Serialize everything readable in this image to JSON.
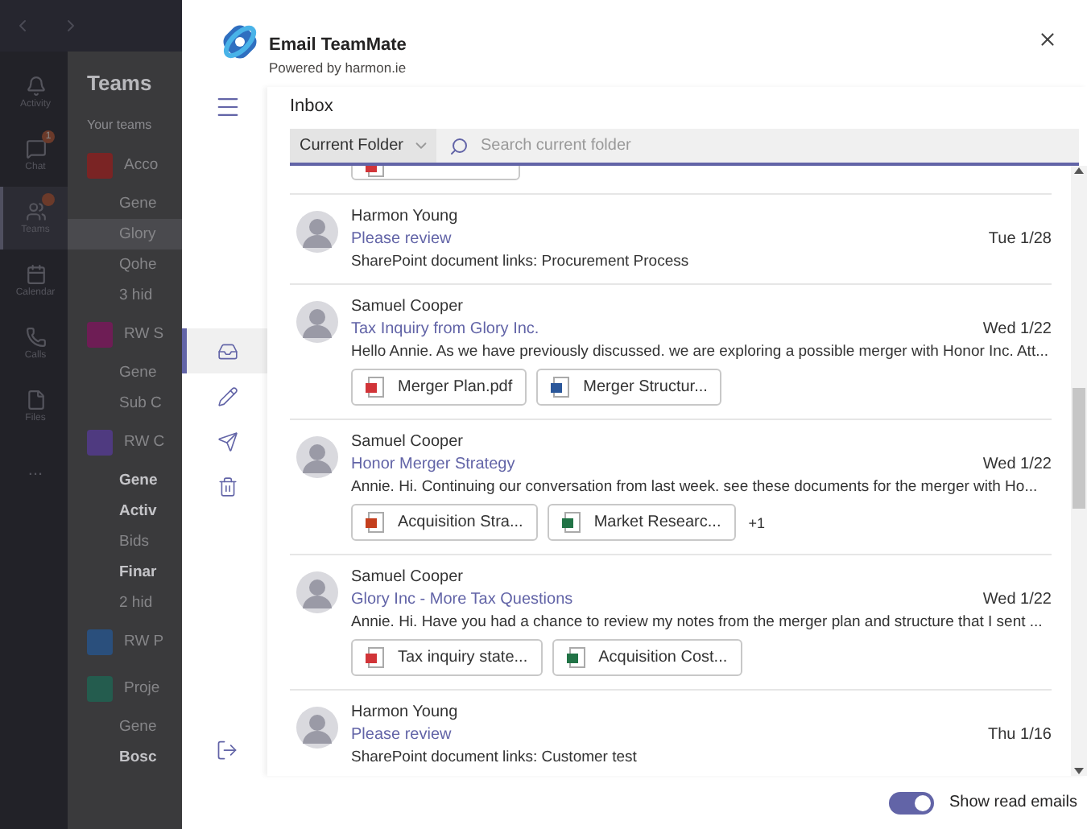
{
  "teams_app": {
    "nav": [
      {
        "kind": "activity",
        "label": "Activity",
        "notified": false
      },
      {
        "kind": "chat",
        "label": "Chat",
        "notified": true,
        "badge_count": "1"
      },
      {
        "kind": "teams",
        "label": "Teams",
        "notified": true,
        "selected": true
      },
      {
        "kind": "calendar",
        "label": "Calendar",
        "notified": false
      },
      {
        "kind": "calls",
        "label": "Calls",
        "notified": false
      },
      {
        "kind": "files",
        "label": "Files",
        "notified": false
      },
      {
        "kind": "more",
        "label": "...",
        "notified": false
      }
    ],
    "panel": {
      "title": "Teams",
      "section": "Your teams",
      "items": [
        {
          "kind": "team",
          "text": "Acco",
          "color": "#7a2424"
        },
        {
          "kind": "channel",
          "text": "Gene",
          "bold": false,
          "selected": false
        },
        {
          "kind": "channel",
          "text": "Glory",
          "bold": false,
          "selected": true
        },
        {
          "kind": "channel",
          "text": "Qohe",
          "bold": false,
          "selected": false
        },
        {
          "kind": "hidden",
          "text": "3 hid"
        },
        {
          "kind": "team",
          "text": "RW S",
          "color": "#6e1d55"
        },
        {
          "kind": "channel",
          "text": "Gene",
          "bold": false,
          "selected": false
        },
        {
          "kind": "channel",
          "text": "Sub C",
          "bold": false,
          "selected": false
        },
        {
          "kind": "team",
          "text": "RW C",
          "color": "#4f3a80"
        },
        {
          "kind": "channel",
          "text": "Gene",
          "bold": true,
          "selected": false
        },
        {
          "kind": "channel",
          "text": "Activ",
          "bold": true,
          "selected": false
        },
        {
          "kind": "channel",
          "text": "Bids",
          "bold": false,
          "selected": false
        },
        {
          "kind": "channel",
          "text": "Finar",
          "bold": true,
          "selected": false
        },
        {
          "kind": "hidden",
          "text": "2 hid"
        },
        {
          "kind": "team",
          "text": "RW P",
          "color": "#2a4f7c"
        },
        {
          "kind": "team",
          "text": "Proje",
          "color": "#245c4e"
        },
        {
          "kind": "channel",
          "text": "Gene",
          "bold": false,
          "selected": false
        },
        {
          "kind": "channel",
          "text": "Bosc",
          "bold": true,
          "selected": false
        }
      ]
    }
  },
  "dialog": {
    "app_name": "Email TeamMate",
    "tagline": "Powered by harmon.ie",
    "sidebar_actions": [
      {
        "kind": "inbox",
        "selected": true
      },
      {
        "kind": "compose",
        "selected": false
      },
      {
        "kind": "sent",
        "selected": false
      },
      {
        "kind": "trash",
        "selected": false
      }
    ],
    "folder": "Inbox",
    "scope": "Current Folder",
    "search": {
      "placeholder": "Search current folder"
    },
    "emails": [
      {
        "partial": true,
        "attachments": [
          {
            "kind": "pdf"
          }
        ]
      },
      {
        "sender": "Harmon Young",
        "subject": "Please review",
        "date": "Tue 1/28",
        "preview": "SharePoint document links: Procurement Process"
      },
      {
        "sender": "Samuel Cooper",
        "subject": "Tax Inquiry from Glory Inc.",
        "date": "Wed 1/22",
        "preview": "Hello Annie.  As we have previously discussed. we are exploring a possible merger with Honor Inc. Att...",
        "attachments": [
          {
            "kind": "pdf",
            "name": "Merger Plan.pdf"
          },
          {
            "kind": "word",
            "name": "Merger Structur..."
          }
        ]
      },
      {
        "sender": "Samuel Cooper",
        "subject": "Honor Merger Strategy",
        "date": "Wed 1/22",
        "preview": "Annie.  Hi. Continuing our conversation from last week. see these documents for the merger with Ho...",
        "attachments": [
          {
            "kind": "powerpoint",
            "name": "Acquisition Stra..."
          },
          {
            "kind": "excel",
            "name": "Market Researc..."
          }
        ],
        "more": "+1"
      },
      {
        "sender": "Samuel Cooper",
        "subject": "Glory Inc - More Tax Questions",
        "date": "Wed 1/22",
        "preview": "Annie.  Hi. Have you had a chance to review my notes from the merger plan and structure that I sent ...",
        "attachments": [
          {
            "kind": "pdf",
            "name": "Tax inquiry state..."
          },
          {
            "kind": "excel",
            "name": "Acquisition Cost..."
          }
        ]
      },
      {
        "sender": "Harmon Young",
        "subject": "Please review",
        "date": "Thu 1/16",
        "preview": "SharePoint document links: Customer test"
      }
    ],
    "show_read_emails": {
      "label": "Show read emails",
      "on": true
    }
  }
}
